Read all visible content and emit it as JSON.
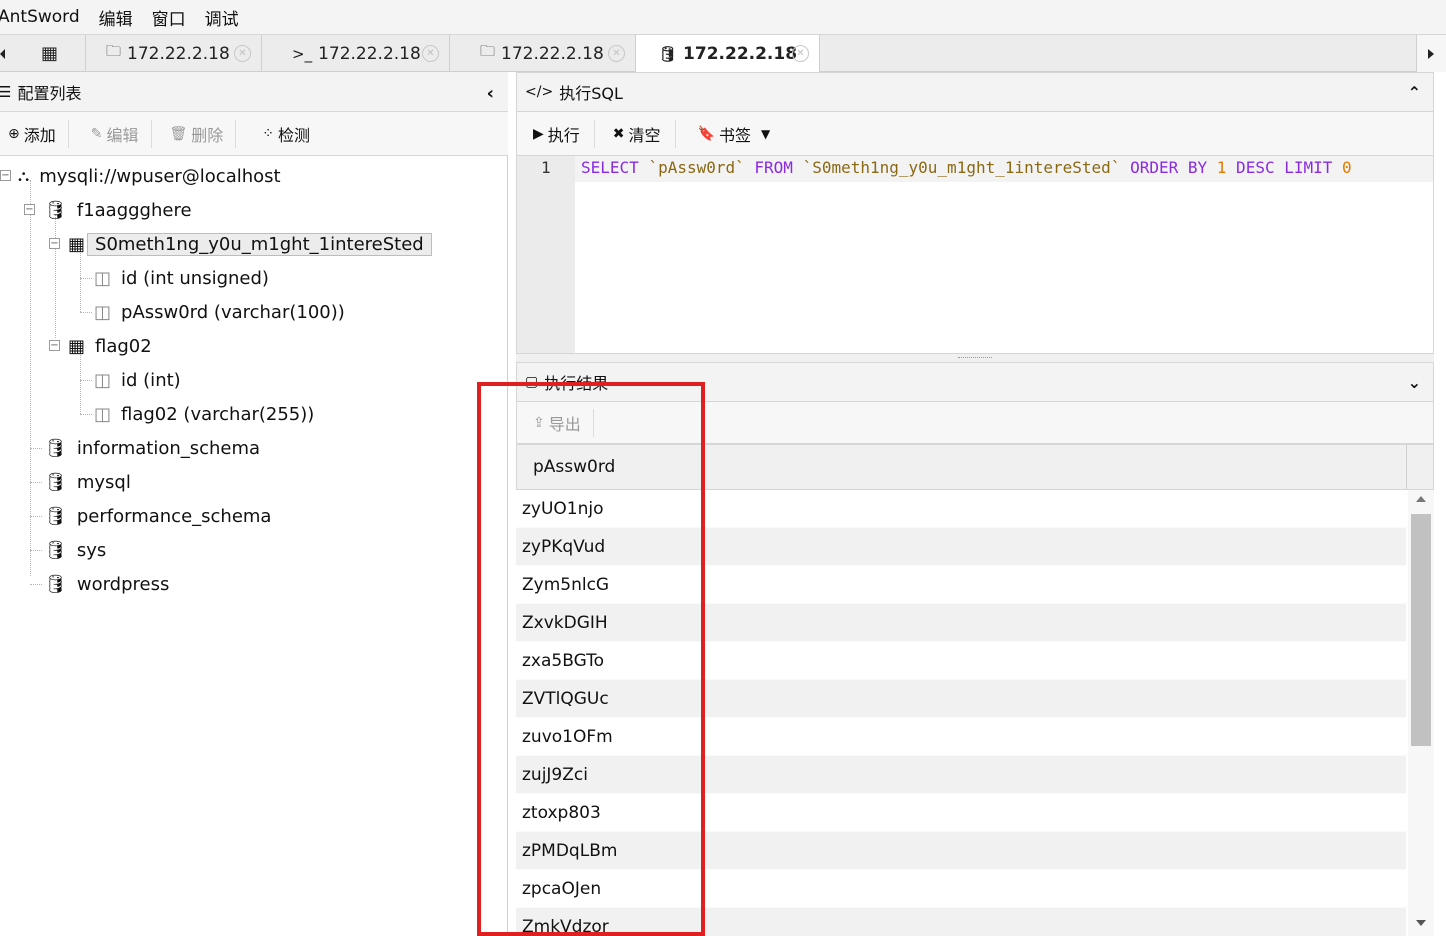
{
  "menu": {
    "app": "AntSword",
    "edit": "编辑",
    "window": "窗口",
    "debug": "调试"
  },
  "tabs": [
    {
      "icon": "grid-icon",
      "label": ""
    },
    {
      "icon": "folder-icon",
      "label": "172.22.2.18"
    },
    {
      "icon": "terminal-icon",
      "label": "172.22.2.18"
    },
    {
      "icon": "folder-icon",
      "label": "172.22.2.18"
    },
    {
      "icon": "database-icon",
      "label": "172.22.2.18"
    }
  ],
  "left": {
    "title": "配置列表",
    "toolbar": {
      "add": "添加",
      "edit": "编辑",
      "delete": "删除",
      "check": "检测"
    },
    "tree": {
      "root": "mysqli://wpuser@localhost",
      "db1": "f1aaggghere",
      "table1": "S0meth1ng_y0u_m1ght_1intereSted",
      "table1_col1": "id (int unsigned)",
      "table1_col2": "pAssw0rd (varchar(100))",
      "table2": "flag02",
      "table2_col1": "id (int)",
      "table2_col2": "flag02 (varchar(255))",
      "db2": "information_schema",
      "db3": "mysql",
      "db4": "performance_schema",
      "db5": "sys",
      "db6": "wordpress"
    }
  },
  "sql": {
    "title": "执行SQL",
    "toolbar": {
      "run": "执行",
      "clear": "清空",
      "bookmark": "书签"
    },
    "line_no": "1",
    "code": {
      "k1": "SELECT ",
      "s1": "`pAssw0rd`",
      "k2": " FROM ",
      "s2": "`S0meth1ng_y0u_m1ght_1intereSted`",
      "k3": " ORDER BY ",
      "n1": "1",
      "k4": " DESC LIMIT ",
      "n2": "0"
    }
  },
  "results": {
    "title": "执行结果",
    "export": "导出",
    "column": "pAssw0rd",
    "rows": [
      "zyUO1njo",
      "zyPKqVud",
      "Zym5nlcG",
      "ZxvkDGIH",
      "zxa5BGTo",
      "ZVTlQGUc",
      "zuvo1OFm",
      "zujJ9Zci",
      "ztoxp803",
      "zPMDqLBm",
      "zpcaOJen",
      "ZmkVdzor"
    ]
  },
  "colors": {
    "highlight_box": "#e02020",
    "sql_keyword": "#8a2be2",
    "sql_identifier": "#8b6914",
    "sql_number": "#e07b00"
  }
}
